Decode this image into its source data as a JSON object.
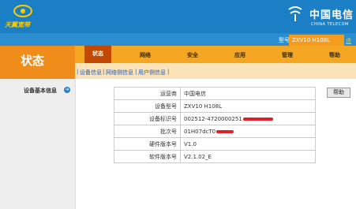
{
  "brand": {
    "name": "天翼宽带"
  },
  "telecom": {
    "cn": "中国电信",
    "en": "CHINA TELECOM"
  },
  "model": {
    "label": "型号:",
    "value": "ZXV10 H108L",
    "logout": "退出"
  },
  "section_title": "状态",
  "nav": {
    "tabs": [
      {
        "label": "状态",
        "active": true
      },
      {
        "label": "网络"
      },
      {
        "label": "安全"
      },
      {
        "label": "应用"
      },
      {
        "label": "管理"
      },
      {
        "label": "帮助"
      }
    ],
    "subnav": [
      "设备信息",
      "网络侧信息",
      "用户侧信息"
    ]
  },
  "sidebar": {
    "item": "设备基本信息"
  },
  "device_info": {
    "rows": [
      {
        "key": "运营商",
        "value": "中国电信"
      },
      {
        "key": "设备型号",
        "value": "ZXV10 H108L"
      },
      {
        "key": "设备标识号",
        "value": "002512-4720000251"
      },
      {
        "key": "批次号",
        "value": "01H07dcT0"
      },
      {
        "key": "硬件版本号",
        "value": "V1.0"
      },
      {
        "key": "软件版本号",
        "value": "V2.1.02_E"
      }
    ]
  },
  "help_button": "帮助",
  "colors": {
    "banner": "#1a7fc4",
    "orange": "#f08c1a",
    "nav": "#f5a623",
    "active_tab": "#c24a00"
  }
}
